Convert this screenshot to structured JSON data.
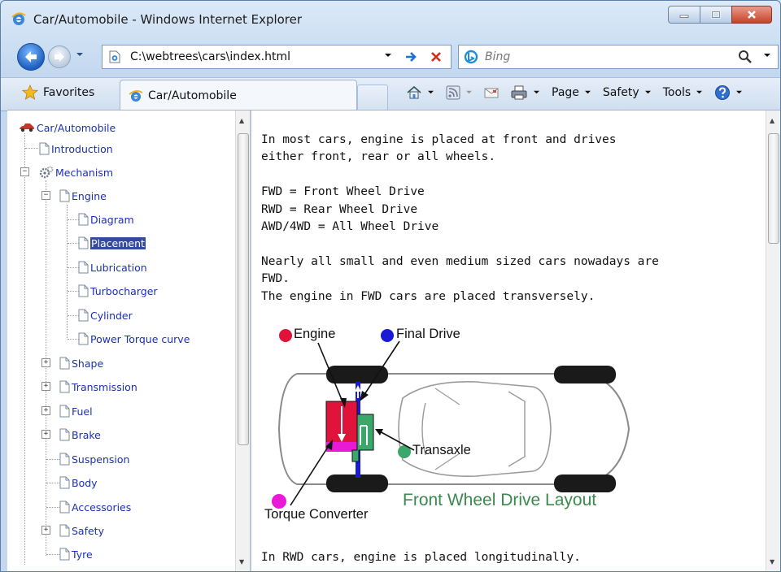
{
  "window": {
    "title": "Car/Automobile - Windows Internet Explorer"
  },
  "navigation": {
    "address": "C:\\webtrees\\cars\\index.html",
    "search_placeholder": "Bing"
  },
  "commandbar": {
    "favorites_label": "Favorites",
    "tab_label": "Car/Automobile",
    "page_label": "Page",
    "safety_label": "Safety",
    "tools_label": "Tools"
  },
  "tree": {
    "root": "Car/Automobile",
    "introduction": "Introduction",
    "mechanism": "Mechanism",
    "engine": "Engine",
    "diagram": "Diagram",
    "placement": "Placement",
    "lubrication": "Lubrication",
    "turbocharger": "Turbocharger",
    "cylinder": "Cylinder",
    "power_torque_curve": "Power Torque curve",
    "shape": "Shape",
    "transmission": "Transmission",
    "fuel": "Fuel",
    "brake": "Brake",
    "suspension": "Suspension",
    "body": "Body",
    "accessories": "Accessories",
    "safety": "Safety",
    "tyre": "Tyre"
  },
  "document": {
    "text": "In most cars, engine is placed at front and drives\neither front, rear or all wheels.\n\nFWD = Front Wheel Drive\nRWD = Rear Wheel Drive\nAWD/4WD = All Wheel Drive\n\nNearly all small and even medium sized cars nowadays are\nFWD.\nThe engine in FWD cars are placed transversely.",
    "diagram": {
      "engine_label": "Engine",
      "final_drive_label": "Final Drive",
      "transaxle_label": "Transaxle",
      "torque_converter_label": "Torque Converter",
      "caption": "Front Wheel Drive Layout",
      "colors": {
        "engine": "#e0143a",
        "final_drive": "#1a1ad6",
        "transaxle": "#3aa86a",
        "torque_converter": "#e81ad6",
        "caption": "#3a8a4e"
      }
    },
    "last_line": "In RWD cars, engine is placed longitudinally."
  }
}
